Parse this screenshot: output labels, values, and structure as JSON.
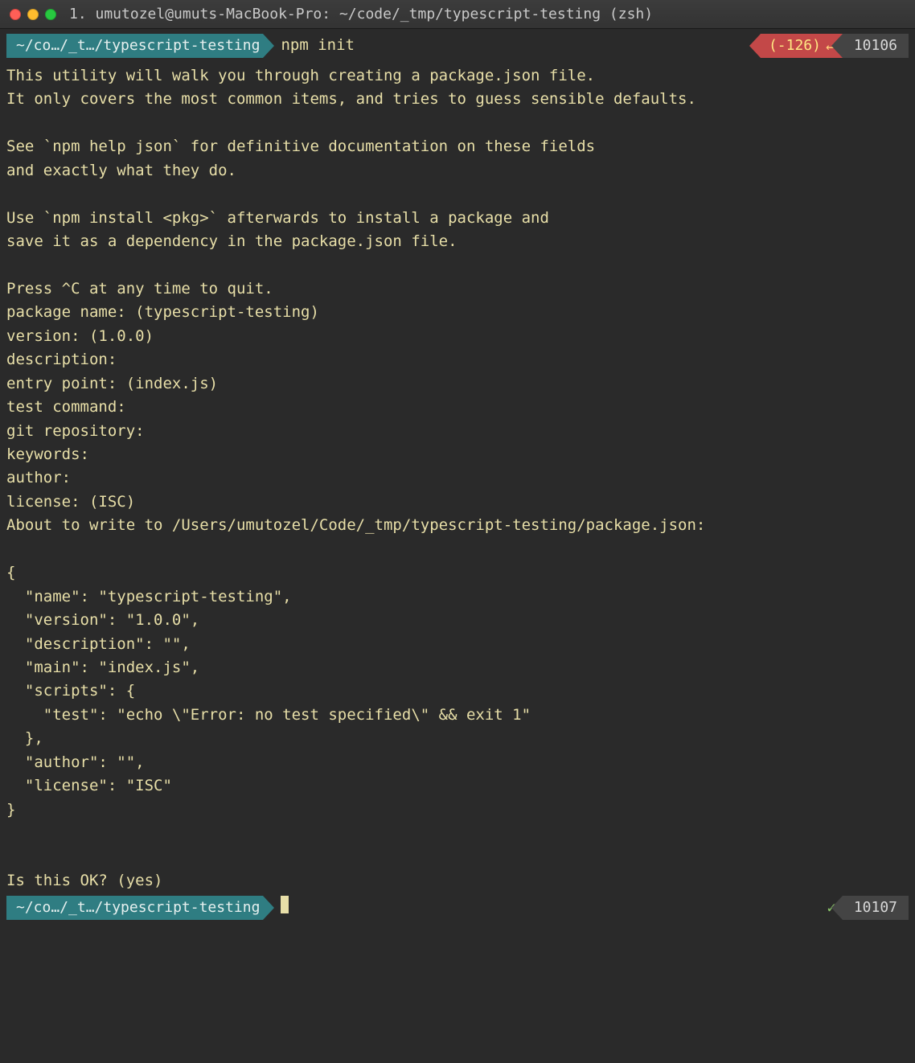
{
  "window": {
    "title": "1. umutozel@umuts-MacBook-Pro: ~/code/_tmp/typescript-testing (zsh)"
  },
  "prompt1": {
    "path": "~/co…/_t…/typescript-testing",
    "command": "npm init",
    "err": "(-126)",
    "ret_glyph": "↵",
    "history": "10106"
  },
  "output": "This utility will walk you through creating a package.json file.\nIt only covers the most common items, and tries to guess sensible defaults.\n\nSee `npm help json` for definitive documentation on these fields\nand exactly what they do.\n\nUse `npm install <pkg>` afterwards to install a package and\nsave it as a dependency in the package.json file.\n\nPress ^C at any time to quit.\npackage name: (typescript-testing)\nversion: (1.0.0)\ndescription:\nentry point: (index.js)\ntest command:\ngit repository:\nkeywords:\nauthor:\nlicense: (ISC)\nAbout to write to /Users/umutozel/Code/_tmp/typescript-testing/package.json:\n\n{\n  \"name\": \"typescript-testing\",\n  \"version\": \"1.0.0\",\n  \"description\": \"\",\n  \"main\": \"index.js\",\n  \"scripts\": {\n    \"test\": \"echo \\\"Error: no test specified\\\" && exit 1\"\n  },\n  \"author\": \"\",\n  \"license\": \"ISC\"\n}\n\n\nIs this OK? (yes)",
  "prompt2": {
    "path": "~/co…/_t…/typescript-testing",
    "check": "✓",
    "history": "10107"
  }
}
